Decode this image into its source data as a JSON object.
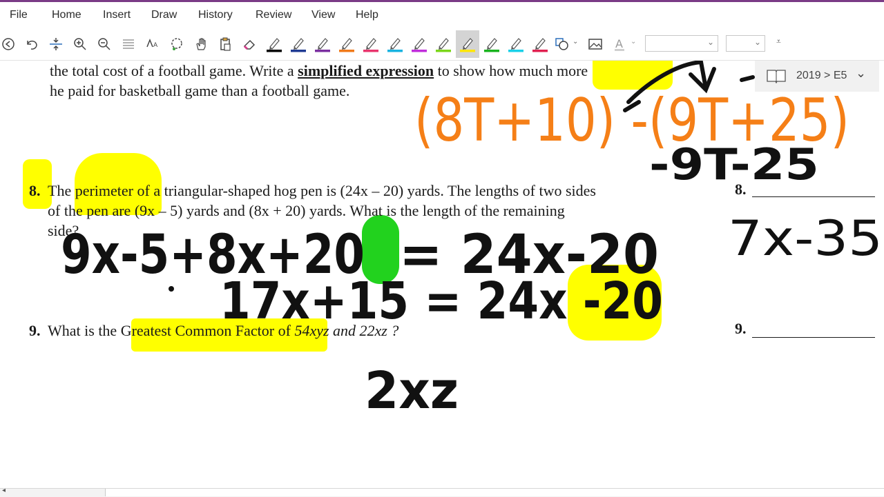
{
  "menu": {
    "items": [
      "File",
      "Home",
      "Insert",
      "Draw",
      "History",
      "Review",
      "View",
      "Help"
    ],
    "accent_color": "#7a3b86"
  },
  "toolbar": {
    "icons": [
      "lasso-back-icon",
      "undo-icon",
      "insert-space-icon",
      "zoom-in-icon",
      "zoom-out-icon",
      "align-icon",
      "ink-to-text-icon",
      "lasso-select-icon",
      "pan-hand-icon",
      "paste-icon",
      "eraser-icon"
    ],
    "pen_colors": [
      "#000000",
      "#1f3a93",
      "#7b2fa0",
      "#f07a1a",
      "#e8356d",
      "#18b3e0",
      "#c02ddb",
      "#7bd61a",
      "#ffe600",
      "#19b31e",
      "#1ad0e8",
      "#e02050"
    ],
    "selected_pen_index": 8,
    "font_dropdown_value": "",
    "size_dropdown_value": ""
  },
  "nav": {
    "crumb": "2019 > E5"
  },
  "document": {
    "line1_pre": "the total cost of a football game.  Write a ",
    "line1_bold": "simplified expression",
    "line1_post": " to show how much more",
    "line2": "he paid for basketball game than a football game.",
    "q8_number": "8.",
    "q8_line1": "The perimeter of a triangular-shaped hog pen is (24x – 20) yards. The lengths of two sides",
    "q8_line2": "of the pen are (9x – 5) yards and (8x + 20) yards. What is the length of the remaining",
    "q8_line3": "side?",
    "q8_answer_label": "8.",
    "q9_number": "9.",
    "q9_pre": "What is the ",
    "q9_highlight": "Greatest Common Factor of",
    "q9_expr": "  54xyz  and  22xz ?",
    "q9_answer_label": "9."
  },
  "ink_text": {
    "orange_expr": "(8T+10) -(9T+25)",
    "black_expand": "-9T-25",
    "answer8": "7x-35",
    "eq1_left": "9x-5+8x+20",
    "eq1_right": "= 24x-20",
    "eq2": "17x+15 = 24x -20",
    "answer9": "2xz"
  },
  "colors": {
    "highlight_yellow": "#ffff00",
    "highlight_green": "#22d21e",
    "ink_orange": "#f57f17",
    "ink_black": "#111111"
  }
}
